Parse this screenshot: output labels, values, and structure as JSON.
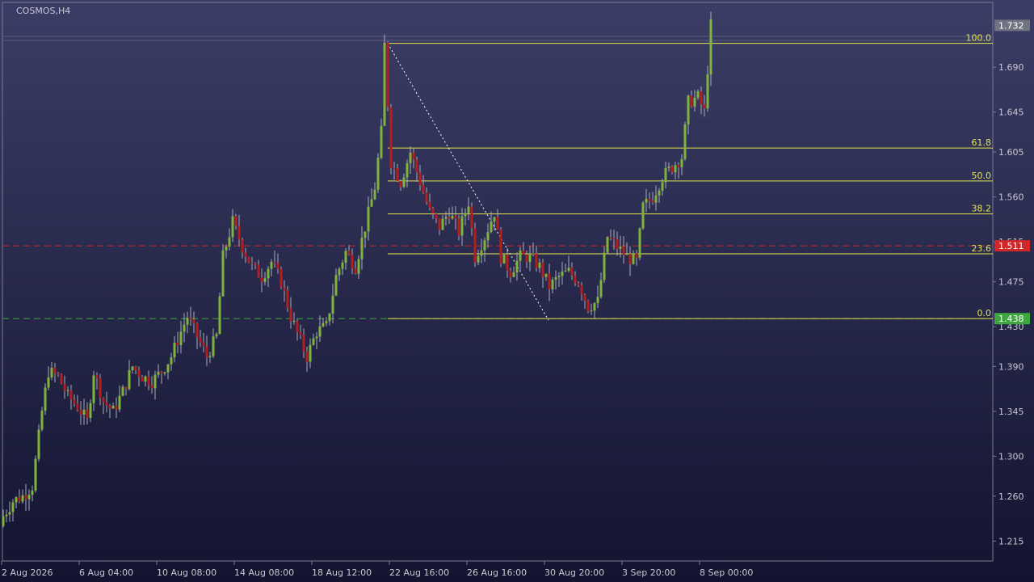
{
  "symbol_label": "COSMOS,H4",
  "colors": {
    "bg_top": "#3b3d66",
    "bg_bottom": "#131430",
    "axis_text": "#c8c8d0",
    "frame": "#7a7c94",
    "bull": "#7fb43c",
    "bear": "#b41e1e",
    "wick": "#a9aab8",
    "fib": "#e6e64a",
    "red_level": "#d02828",
    "green_level": "#3ea83e",
    "badge_text": "#ffffff",
    "price_badge_bg": "#707382"
  },
  "chart_data": {
    "type": "candlestick",
    "symbol": "COSMOS",
    "timeframe": "H4",
    "y_ticks": [
      "1.690",
      "1.645",
      "1.605",
      "1.560",
      "1.515",
      "1.475",
      "1.430",
      "1.390",
      "1.345",
      "1.300",
      "1.260",
      "1.215"
    ],
    "x_ticks": [
      "2 Aug 2026",
      "6 Aug 04:00",
      "10 Aug 08:00",
      "14 Aug 08:00",
      "18 Aug 12:00",
      "22 Aug 16:00",
      "26 Aug 16:00",
      "30 Aug 20:00",
      "3 Sep 20:00",
      "8 Sep 00:00"
    ],
    "ylim": [
      1.195,
      1.755
    ],
    "current_price": "1.732",
    "levels": [
      {
        "price": "1.511",
        "style": "dashed",
        "color": "red"
      },
      {
        "price": "1.438",
        "style": "dashed",
        "color": "green"
      }
    ],
    "fibonacci": {
      "high": 1.714,
      "low": 1.438,
      "levels": [
        {
          "label": "100.0",
          "value": 1.714
        },
        {
          "label": "61.8",
          "value": 1.609
        },
        {
          "label": "50.0",
          "value": 1.576
        },
        {
          "label": "38.2",
          "value": 1.543
        },
        {
          "label": "23.6",
          "value": 1.503
        },
        {
          "label": "0.0",
          "value": 1.438
        }
      ]
    },
    "close_path": [
      [
        0,
        1.24
      ],
      [
        3,
        1.255
      ],
      [
        6,
        1.26
      ],
      [
        9,
        1.27
      ],
      [
        12,
        1.345
      ],
      [
        14,
        1.385
      ],
      [
        17,
        1.38
      ],
      [
        20,
        1.36
      ],
      [
        23,
        1.35
      ],
      [
        26,
        1.335
      ],
      [
        28,
        1.385
      ],
      [
        31,
        1.355
      ],
      [
        34,
        1.345
      ],
      [
        37,
        1.365
      ],
      [
        40,
        1.39
      ],
      [
        43,
        1.38
      ],
      [
        46,
        1.375
      ],
      [
        49,
        1.385
      ],
      [
        52,
        1.4
      ],
      [
        55,
        1.425
      ],
      [
        57,
        1.44
      ],
      [
        60,
        1.42
      ],
      [
        63,
        1.4
      ],
      [
        66,
        1.42
      ],
      [
        68,
        1.5
      ],
      [
        71,
        1.535
      ],
      [
        74,
        1.51
      ],
      [
        77,
        1.49
      ],
      [
        80,
        1.48
      ],
      [
        83,
        1.495
      ],
      [
        86,
        1.475
      ],
      [
        89,
        1.44
      ],
      [
        92,
        1.415
      ],
      [
        94,
        1.4
      ],
      [
        97,
        1.425
      ],
      [
        100,
        1.43
      ],
      [
        103,
        1.48
      ],
      [
        106,
        1.505
      ],
      [
        109,
        1.49
      ],
      [
        112,
        1.53
      ],
      [
        115,
        1.57
      ],
      [
        117,
        1.625
      ],
      [
        118,
        1.712
      ],
      [
        120,
        1.595
      ],
      [
        123,
        1.575
      ],
      [
        126,
        1.605
      ],
      [
        129,
        1.575
      ],
      [
        132,
        1.545
      ],
      [
        135,
        1.53
      ],
      [
        138,
        1.545
      ],
      [
        141,
        1.525
      ],
      [
        144,
        1.555
      ],
      [
        146,
        1.5
      ],
      [
        149,
        1.52
      ],
      [
        152,
        1.545
      ],
      [
        154,
        1.5
      ],
      [
        157,
        1.485
      ],
      [
        160,
        1.5
      ],
      [
        163,
        1.5
      ],
      [
        166,
        1.49
      ],
      [
        169,
        1.47
      ],
      [
        172,
        1.48
      ],
      [
        175,
        1.485
      ],
      [
        178,
        1.475
      ],
      [
        181,
        1.45
      ],
      [
        184,
        1.455
      ],
      [
        187,
        1.52
      ],
      [
        190,
        1.51
      ],
      [
        193,
        1.5
      ],
      [
        196,
        1.495
      ],
      [
        198,
        1.55
      ],
      [
        201,
        1.56
      ],
      [
        204,
        1.58
      ],
      [
        207,
        1.59
      ],
      [
        210,
        1.6
      ],
      [
        212,
        1.655
      ],
      [
        215,
        1.66
      ],
      [
        217,
        1.645
      ],
      [
        219,
        1.732
      ]
    ]
  }
}
